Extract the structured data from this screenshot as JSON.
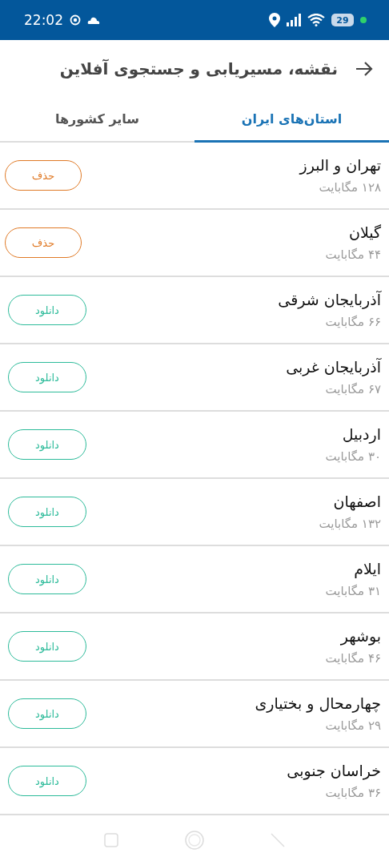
{
  "status_bar": {
    "time": "22:02",
    "battery": "29"
  },
  "header": {
    "title": "نقشه، مسیریابی و جستجوی آفلاین"
  },
  "tabs": [
    {
      "label": "استان‌های ایران",
      "selected": true
    },
    {
      "label": "سایر کشورها",
      "selected": false
    }
  ],
  "regions": [
    {
      "name": "تهران و البرز",
      "size": "۱۲۸ مگابایت",
      "action": {
        "kind": "delete",
        "label": "حذف"
      }
    },
    {
      "name": "گیلان",
      "size": "۴۴ مگابایت",
      "action": {
        "kind": "delete",
        "label": "حذف"
      }
    },
    {
      "name": "آذربایجان شرقی",
      "size": "۶۶ مگابایت",
      "action": {
        "kind": "download",
        "label": "دانلود"
      }
    },
    {
      "name": "آذربایجان غربی",
      "size": "۶۷ مگابایت",
      "action": {
        "kind": "download",
        "label": "دانلود"
      }
    },
    {
      "name": "اردبیل",
      "size": "۳۰ مگابایت",
      "action": {
        "kind": "download",
        "label": "دانلود"
      }
    },
    {
      "name": "اصفهان",
      "size": "۱۳۲ مگابایت",
      "action": {
        "kind": "download",
        "label": "دانلود"
      }
    },
    {
      "name": "ایلام",
      "size": "۳۱ مگابایت",
      "action": {
        "kind": "download",
        "label": "دانلود"
      }
    },
    {
      "name": "بوشهر",
      "size": "۴۶ مگابایت",
      "action": {
        "kind": "download",
        "label": "دانلود"
      }
    },
    {
      "name": "چهارمحال و بختیاری",
      "size": "۲۹ مگابایت",
      "action": {
        "kind": "download",
        "label": "دانلود"
      }
    },
    {
      "name": "خراسان جنوبی",
      "size": "۳۶ مگابایت",
      "action": {
        "kind": "download",
        "label": "دانلود"
      }
    }
  ]
}
